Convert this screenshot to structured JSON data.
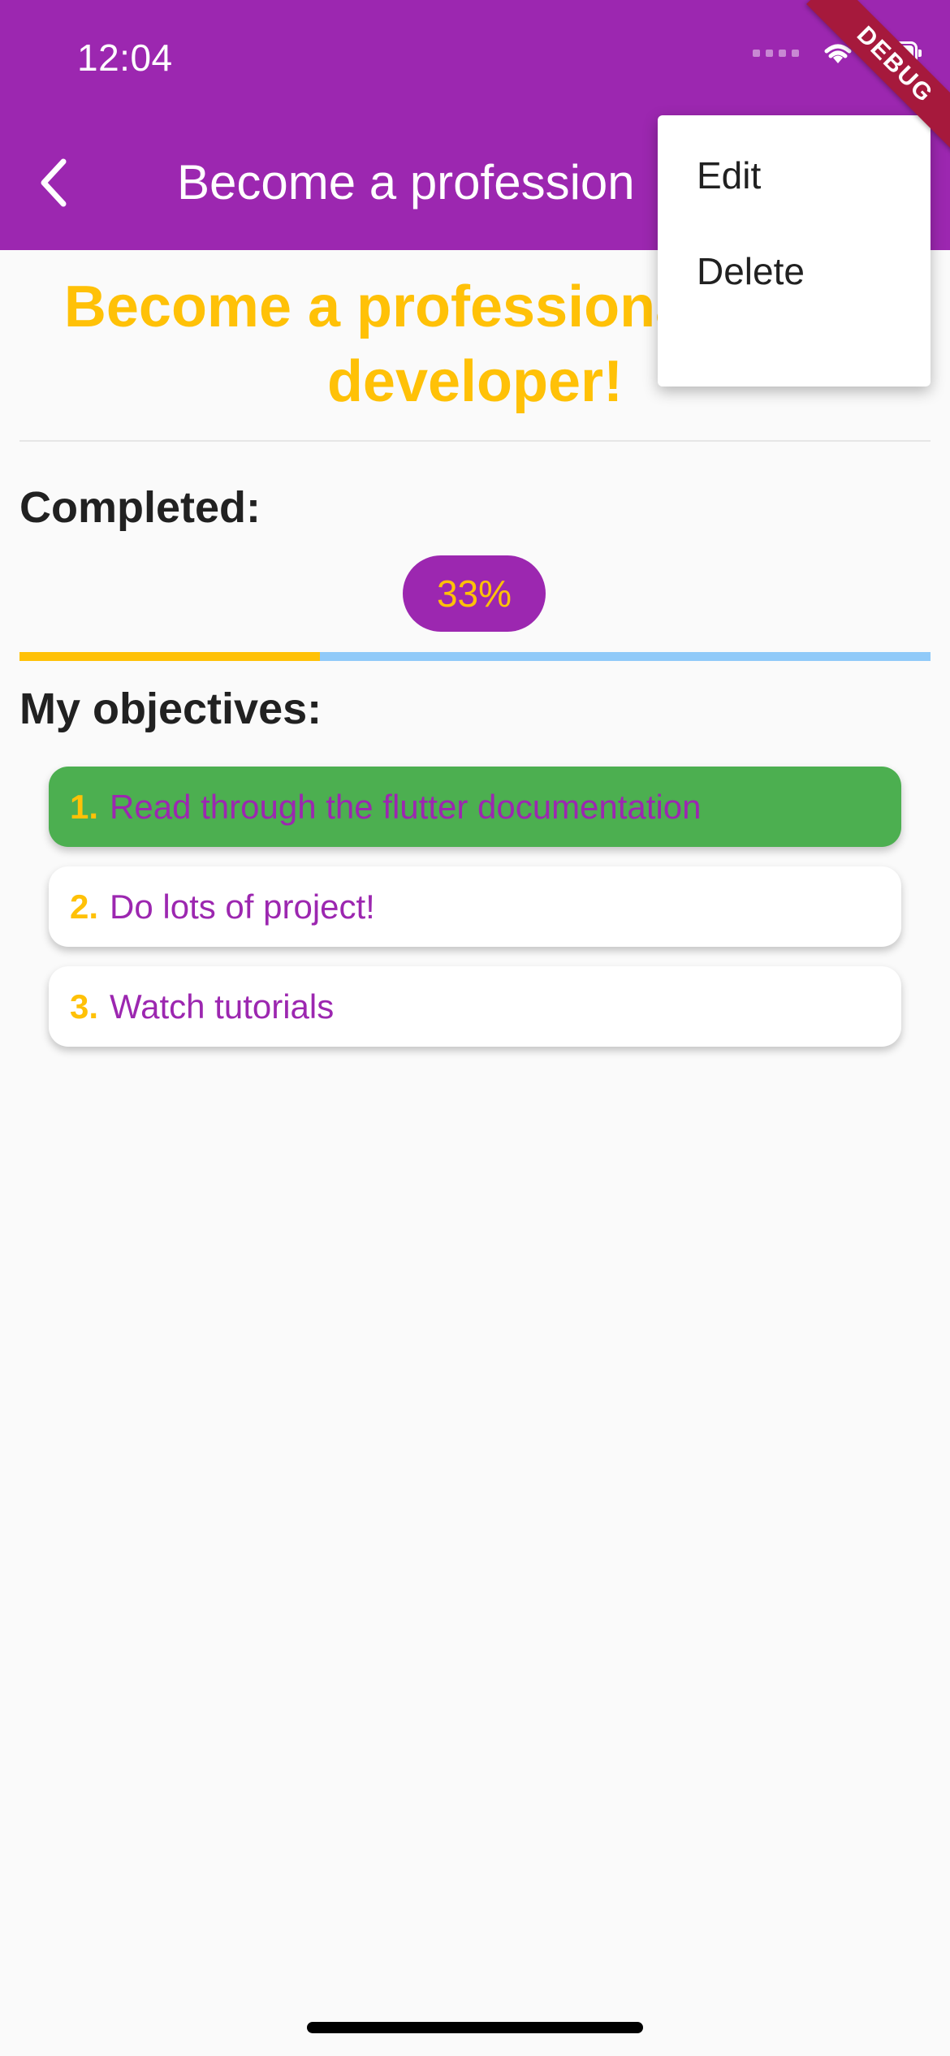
{
  "status_bar": {
    "time": "12:04",
    "icons": [
      "signal-icon",
      "wifi-icon",
      "battery-icon"
    ]
  },
  "app_bar": {
    "title": "Become a profession",
    "back_icon": "chevron-left-icon",
    "color": "#9c27b0"
  },
  "debug_banner": "DEBUG",
  "popup_menu": {
    "items": [
      {
        "label": "Edit"
      },
      {
        "label": "Delete"
      }
    ]
  },
  "goal": {
    "title": "Become a professional flutter developer!",
    "title_color": "#ffc107"
  },
  "progress": {
    "label": "Completed:",
    "percent_text": "33%",
    "fraction": 0.33,
    "fill_color": "#ffc107",
    "track_color": "#90caf9"
  },
  "objectives": {
    "label": "My objectives:",
    "items": [
      {
        "number": "1.",
        "text": "Read through the flutter documentation",
        "done": true
      },
      {
        "number": "2.",
        "text": "Do lots of project!",
        "done": false
      },
      {
        "number": "3.",
        "text": "Watch tutorials",
        "done": false
      }
    ],
    "done_color": "#4caf50"
  }
}
